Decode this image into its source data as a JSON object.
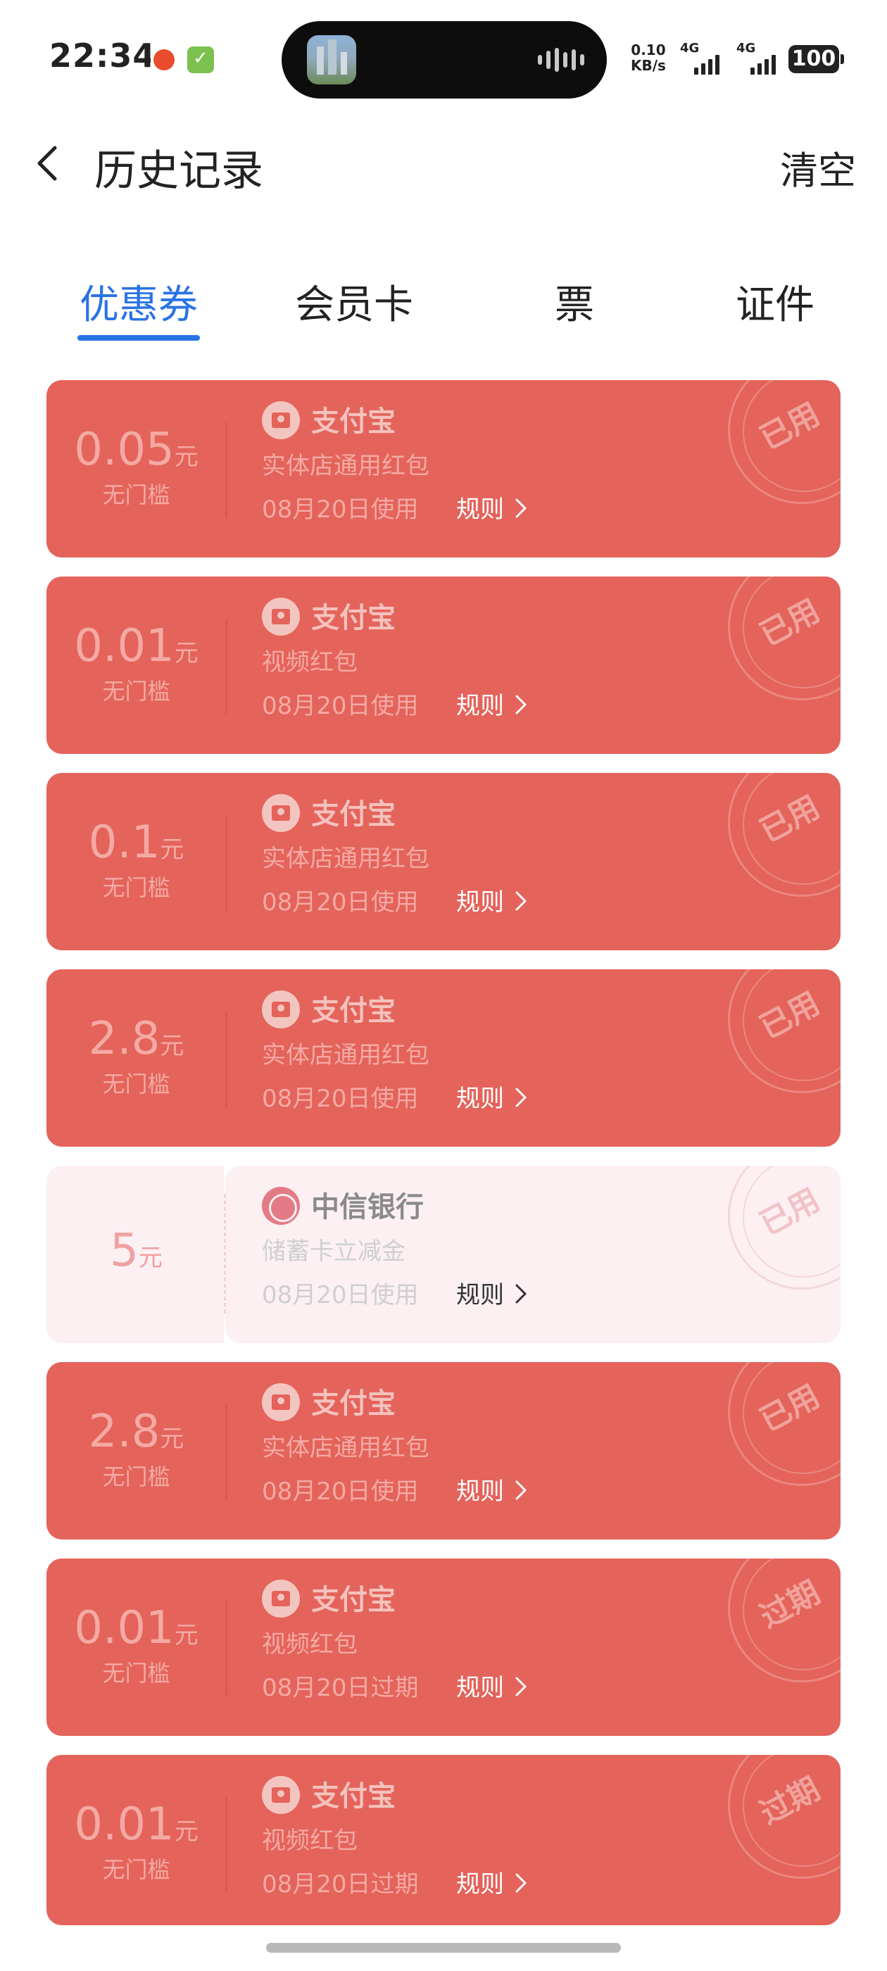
{
  "status_bar": {
    "time": "22:34",
    "net_speed_value": "0.10",
    "net_speed_unit": "KB/s",
    "signal_1_label": "4G",
    "signal_2_label": "4G",
    "battery": "100"
  },
  "header": {
    "title": "历史记录",
    "clear_label": "清空",
    "back_icon": "chevron-left-icon"
  },
  "tabs": [
    {
      "label": "优惠券",
      "active": true
    },
    {
      "label": "会员卡",
      "active": false
    },
    {
      "label": "票",
      "active": false
    },
    {
      "label": "证件",
      "active": false
    }
  ],
  "accent_color": "#2a73e6",
  "coupons": [
    {
      "amount": "0.05",
      "unit": "元",
      "threshold": "无门槛",
      "brand": "支付宝",
      "desc": "实体店通用红包",
      "date": "08月20日使用",
      "rule": "规则",
      "stamp": "已用",
      "style": "red"
    },
    {
      "amount": "0.01",
      "unit": "元",
      "threshold": "无门槛",
      "brand": "支付宝",
      "desc": "视频红包",
      "date": "08月20日使用",
      "rule": "规则",
      "stamp": "已用",
      "style": "red"
    },
    {
      "amount": "0.1",
      "unit": "元",
      "threshold": "无门槛",
      "brand": "支付宝",
      "desc": "实体店通用红包",
      "date": "08月20日使用",
      "rule": "规则",
      "stamp": "已用",
      "style": "red"
    },
    {
      "amount": "2.8",
      "unit": "元",
      "threshold": "无门槛",
      "brand": "支付宝",
      "desc": "实体店通用红包",
      "date": "08月20日使用",
      "rule": "规则",
      "stamp": "已用",
      "style": "red"
    },
    {
      "amount": "5",
      "unit": "元",
      "threshold": "",
      "brand": "中信银行",
      "desc": "储蓄卡立减金",
      "date": "08月20日使用",
      "rule": "规则",
      "stamp": "已用",
      "style": "pale"
    },
    {
      "amount": "2.8",
      "unit": "元",
      "threshold": "无门槛",
      "brand": "支付宝",
      "desc": "实体店通用红包",
      "date": "08月20日使用",
      "rule": "规则",
      "stamp": "已用",
      "style": "red"
    },
    {
      "amount": "0.01",
      "unit": "元",
      "threshold": "无门槛",
      "brand": "支付宝",
      "desc": "视频红包",
      "date": "08月20日过期",
      "rule": "规则",
      "stamp": "过期",
      "style": "red"
    },
    {
      "amount": "0.01",
      "unit": "元",
      "threshold": "无门槛",
      "brand": "支付宝",
      "desc": "视频红包",
      "date": "08月20日过期",
      "rule": "规则",
      "stamp": "过期",
      "style": "red"
    }
  ]
}
